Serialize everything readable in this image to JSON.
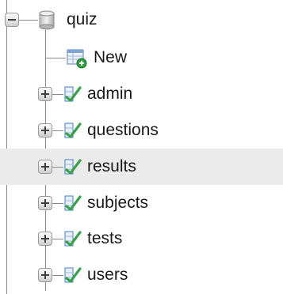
{
  "tree": {
    "database": {
      "name": "quiz",
      "expanded": true,
      "icon": "database-icon"
    },
    "new_item": {
      "label": "New",
      "icon": "new-table-icon"
    },
    "tables": [
      {
        "name": "admin",
        "icon": "table-icon",
        "expanded": false,
        "highlighted": false
      },
      {
        "name": "questions",
        "icon": "table-icon",
        "expanded": false,
        "highlighted": false
      },
      {
        "name": "results",
        "icon": "table-icon",
        "expanded": false,
        "highlighted": true
      },
      {
        "name": "subjects",
        "icon": "table-icon",
        "expanded": false,
        "highlighted": false
      },
      {
        "name": "tests",
        "icon": "table-icon",
        "expanded": false,
        "highlighted": false
      },
      {
        "name": "users",
        "icon": "table-icon",
        "expanded": false,
        "highlighted": false
      }
    ]
  },
  "colors": {
    "highlight_row": "#ebebeb",
    "tree_lines": "#8a8a8a",
    "table_icon_green": "#3aa14a",
    "table_icon_blue": "#3f7fc7",
    "new_badge_green": "#2e9e3e"
  }
}
